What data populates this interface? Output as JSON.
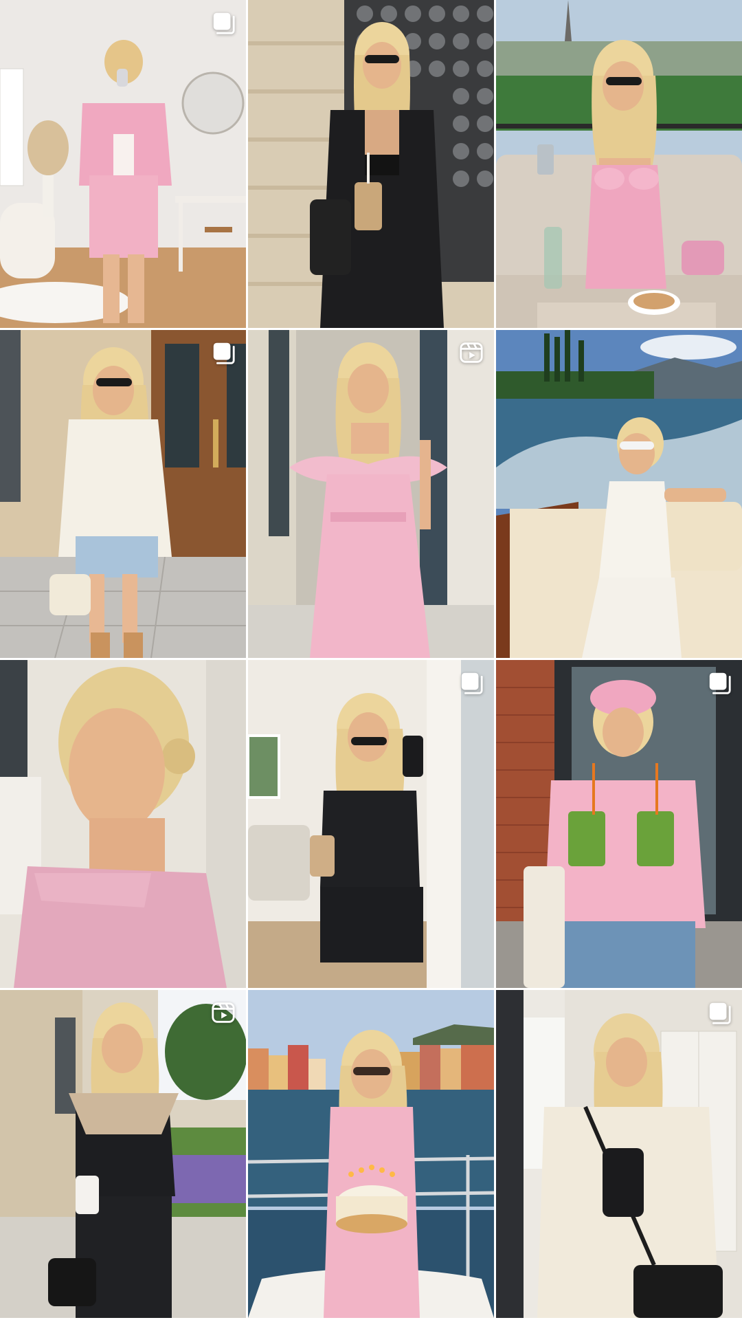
{
  "app": {
    "view": "profile-posts-grid"
  },
  "colors": {
    "badge": "#ffffff",
    "pink": "#f1b7c7",
    "black": "#151515",
    "cream": "#f2ede3",
    "stone": "#cdbfa6",
    "sky": "#a9c7e6",
    "water": "#3f6f8e"
  },
  "posts": [
    {
      "index": 1,
      "badge": "carousel-icon",
      "scene": "pink-tweed-mirror-selfie"
    },
    {
      "index": 2,
      "badge": "none",
      "scene": "black-blazer-iced-coffee"
    },
    {
      "index": 3,
      "badge": "none",
      "scene": "paris-terrace-pink-bow-dress"
    },
    {
      "index": 4,
      "badge": "carousel-icon",
      "scene": "cream-sweater-denim-shorts"
    },
    {
      "index": 5,
      "badge": "reel-icon",
      "scene": "pink-feather-dress"
    },
    {
      "index": 6,
      "badge": "none",
      "scene": "lake-boat-white-dress"
    },
    {
      "index": 7,
      "badge": "none",
      "scene": "pink-strapless-closeup"
    },
    {
      "index": 8,
      "badge": "carousel-icon",
      "scene": "black-romper-mirror-selfie"
    },
    {
      "index": 9,
      "badge": "carousel-icon",
      "scene": "pink-cap-green-smoothies"
    },
    {
      "index": 10,
      "badge": "reel-icon",
      "scene": "black-jumpsuit-coffee"
    },
    {
      "index": 11,
      "badge": "none",
      "scene": "harbor-birthday-cake"
    },
    {
      "index": 12,
      "badge": "carousel-icon",
      "scene": "cream-sweatshirt-mirror-selfie"
    }
  ]
}
